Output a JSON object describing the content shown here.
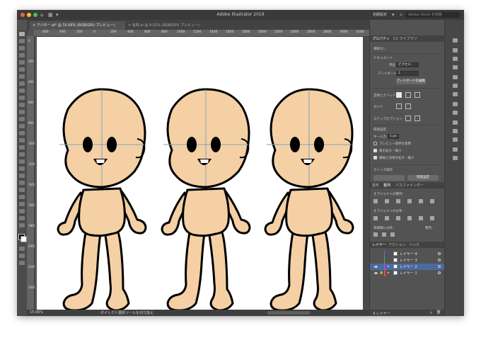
{
  "app": {
    "title": "Adobe Illustrator 2019",
    "workspace": "初期設定",
    "stock_search": "Adobe Stock を検索"
  },
  "doc_tabs": [
    {
      "label": "アバター.ai* @ 15.06% (RGB/GPU プレビュー)",
      "active": true
    },
    {
      "label": "名称.ai @ 9.02% (RGB/GPU プレビュー)",
      "active": false
    }
  ],
  "ruler_h": [
    "600",
    "400",
    "200",
    "0",
    "200",
    "400",
    "600",
    "800",
    "1000",
    "1200",
    "1400",
    "1600",
    "1800",
    "2000",
    "2200",
    "2400",
    "2600",
    "2800",
    "3000",
    "3200"
  ],
  "ruler_v": [
    "0",
    "200",
    "400",
    "600",
    "800",
    "1000",
    "1200",
    "1400",
    "1600",
    "1800",
    "2000",
    "2200",
    "2400"
  ],
  "status": {
    "zoom": "15.06%",
    "tool": "ダイレクト選択ツールを切り換え"
  },
  "properties": {
    "tabs": [
      "プロパティ",
      "CC ライブラリ"
    ],
    "no_selection": "選択なし",
    "document": "ドキュメント",
    "unit_label": "単位 :",
    "unit_value": "ピクセル",
    "artboard_label": "アートボード :",
    "artboard_value": "1",
    "edit_artboard": "アートボードを編集",
    "rulers_grid": "定規とグリッド",
    "guides": "ガイド",
    "snap": "スナップオプション",
    "preferences": "環境設定",
    "key_increment_label": "キー入力 :",
    "key_increment": "1 px",
    "preview_bounds": "プレビュー境界を使用",
    "scale_corners": "角を拡大・縮小",
    "scale_strokes": "線幅と効果を拡大・縮小",
    "quick_actions": "クイック操作",
    "quick_btn": "環境設定"
  },
  "align": {
    "tabs": [
      "変形",
      "整列",
      "パスファインダー"
    ],
    "align_objects": "オブジェクトの整列 :",
    "distribute_objects": "オブジェクトの分布 :",
    "distribute_spacing": "等間隔に分布 :",
    "align_to": "整列 :"
  },
  "layers": {
    "tabs": [
      "レイヤー",
      "アクション",
      "リンク"
    ],
    "items": [
      {
        "name": "レイヤー 4",
        "color": "#4f7ae0",
        "selected": false
      },
      {
        "name": "レイヤー 3",
        "color": "#43b84a",
        "selected": false
      },
      {
        "name": "レイヤー 2",
        "color": "#9a4fd9",
        "selected": true
      },
      {
        "name": "レイヤー 1",
        "color": "#e84a4a",
        "selected": false
      }
    ],
    "footer": "4 レイヤー"
  },
  "colors": {
    "skin": "#f4d0a4",
    "outline": "#000000",
    "guide": "#7fa3b8",
    "window_bg": "#535353"
  }
}
